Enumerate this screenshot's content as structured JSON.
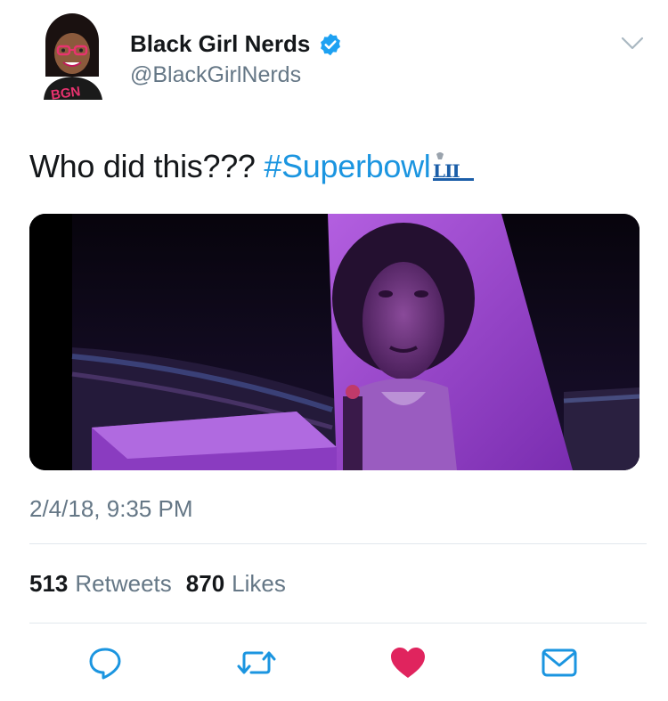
{
  "tweet": {
    "author": {
      "display_name": "Black Girl Nerds",
      "handle": "@BlackGirlNerds",
      "verified": true,
      "avatar_icon": "bgn-avatar-icon",
      "avatar_badge_text": "BGN"
    },
    "text": "Who did this??? ",
    "hashtag": "#Superbowl",
    "hashtag_emoji": "super-bowl-lii-logo-icon",
    "timestamp": "2/4/18, 9:35 PM",
    "stats": {
      "retweets_count": "513",
      "retweets_label": "Retweets",
      "likes_count": "870",
      "likes_label": "Likes"
    },
    "liked": true
  },
  "actions": [
    {
      "name": "reply",
      "icon": "comment-icon"
    },
    {
      "name": "retweet",
      "icon": "retweet-icon"
    },
    {
      "name": "like",
      "icon": "heart-icon"
    },
    {
      "name": "share",
      "icon": "envelope-icon"
    }
  ],
  "colors": {
    "accent": "#1b95e0",
    "verified": "#1da1f2",
    "like": "#e0245e",
    "muted": "#657786",
    "divider": "#e1e8ed",
    "media_purple": "#9b3fc9"
  }
}
